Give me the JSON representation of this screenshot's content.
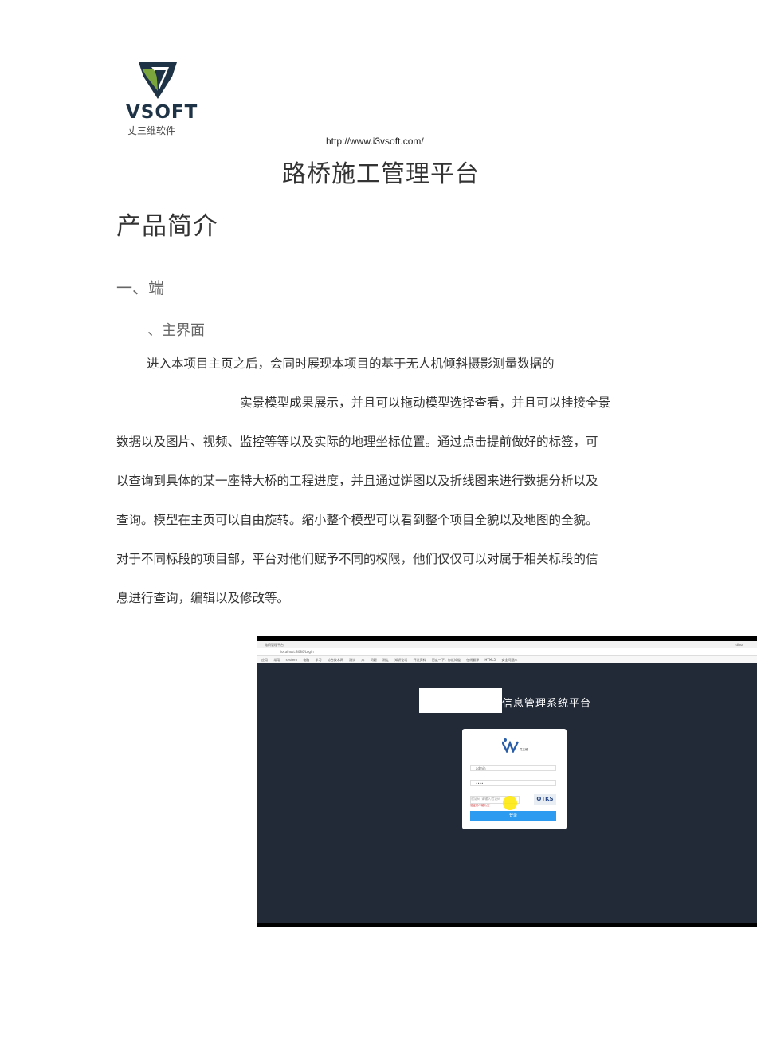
{
  "logo": {
    "brand": "VSOFT",
    "brand_cn": "丈三维软件"
  },
  "header": {
    "url": "http://www.i3vsoft.com/",
    "title": "路桥施工管理平台"
  },
  "section": {
    "heading": "产品简介",
    "sub1": "一、端",
    "sub2": "、主界面"
  },
  "paragraphs": [
    "进入本项目主页之后，会同时展现本项目的基于无人机倾斜摄影测量数据的",
    "实景模型成果展示，并且可以拖动模型选择查看，并且可以挂接全景",
    "数据以及图片、视频、监控等等以及实际的地理坐标位置。通过点击提前做好的标签，可",
    "以查询到具体的某一座特大桥的工程进度，并且通过饼图以及折线图来进行数据分析以及",
    "查询。模型在主页可以自由旋转。缩小整个模型可以看到整个项目全貌以及地图的全貌。",
    "对于不同标段的项目部，平台对他们赋予不同的权限，他们仅仅可以对属于相关标段的信",
    "息进行查询，编辑以及修改等。"
  ],
  "screenshot": {
    "tab": "路桥管理平台",
    "address": "localhost:8080/Login",
    "user": "dlao",
    "bookmarks": [
      "应用",
      "常用",
      "system",
      "电脑",
      "学习",
      "综合技术网",
      "测试",
      "库",
      "问题",
      "测定",
      "知识论坛",
      "开发资料",
      "百度一下，你就知道",
      "在线翻译",
      "HTML5 安全问题库"
    ],
    "system_title": "信息管理系统平台",
    "username": "admin",
    "password": "••••",
    "captcha_placeholder": "请输入验证码",
    "captcha_label": "验证码",
    "captcha_text": "OTKS",
    "error": "验证码不能为空",
    "login_button": "登录",
    "logo_cn": "艾三维"
  }
}
